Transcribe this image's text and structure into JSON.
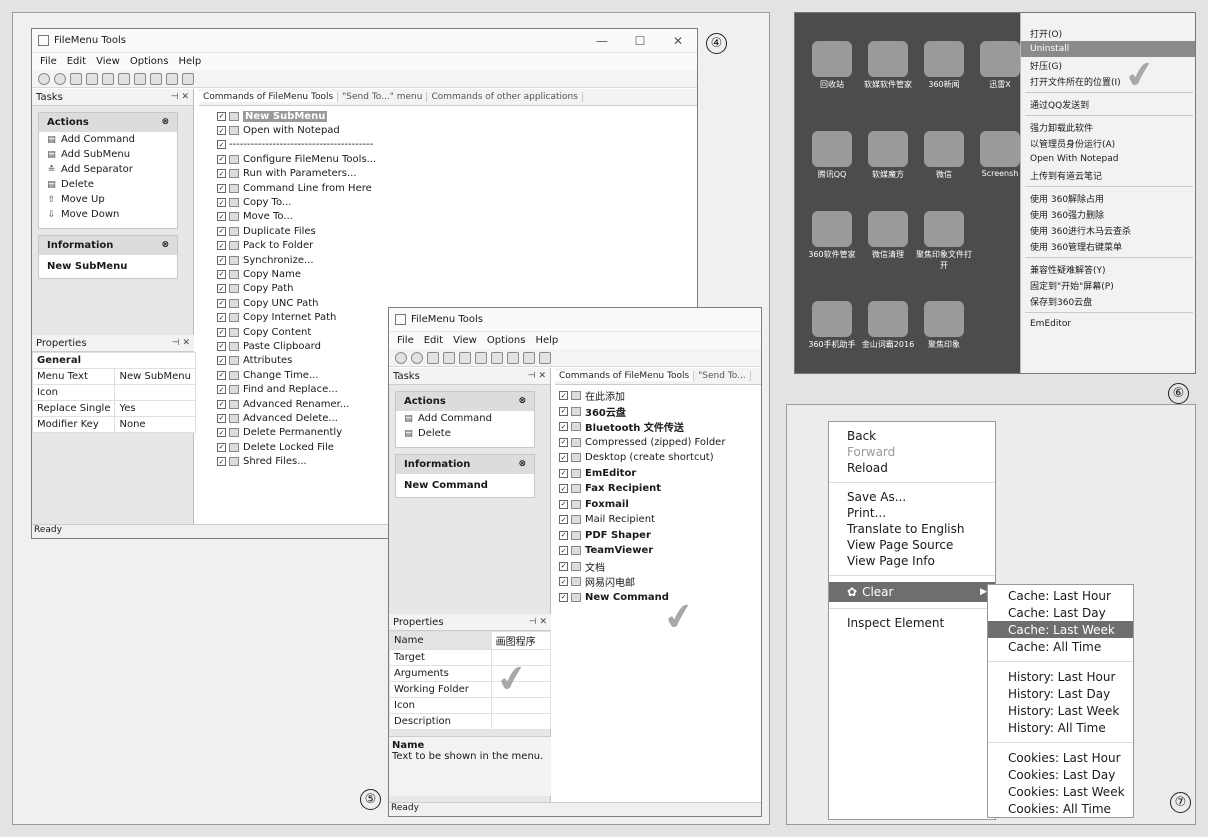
{
  "labels": {
    "n4": "④",
    "n5": "⑤",
    "n6": "⑥",
    "n7": "⑦"
  },
  "win4": {
    "title": "FileMenu Tools",
    "menu": [
      "File",
      "Edit",
      "View",
      "Options",
      "Help"
    ],
    "tasks_header": "Tasks",
    "actions_header": "Actions",
    "actions": [
      "Add Command",
      "Add SubMenu",
      "Add Separator",
      "Delete",
      "Move Up",
      "Move Down"
    ],
    "info_header": "Information",
    "info_text": "New SubMenu",
    "props_header": "Properties",
    "props_group": "General",
    "props": [
      [
        "Menu Text",
        "New SubMenu"
      ],
      [
        "Icon",
        ""
      ],
      [
        "Replace Single",
        "Yes"
      ],
      [
        "Modifier Key",
        "None"
      ]
    ],
    "tabs": [
      "Commands of FileMenu Tools",
      "\"Send To...\" menu",
      "Commands of other applications"
    ],
    "items": [
      "New SubMenu",
      "Open with Notepad",
      "----------------------------------------",
      "Configure FileMenu Tools...",
      "Run with Parameters...",
      "Command Line from Here",
      "Copy To...",
      "Move To...",
      "Duplicate Files",
      "Pack to Folder",
      "Synchronize...",
      "Copy Name",
      "Copy Path",
      "Copy UNC Path",
      "Copy Internet Path",
      "Copy Content",
      "Paste Clipboard",
      "Attributes",
      "Change Time...",
      "Find and Replace...",
      "Advanced Renamer...",
      "Advanced Delete...",
      "Delete Permanently",
      "Delete Locked File",
      "Shred Files..."
    ],
    "status": "Ready"
  },
  "win5": {
    "title": "FileMenu Tools",
    "menu": [
      "File",
      "Edit",
      "View",
      "Options",
      "Help"
    ],
    "tasks_header": "Tasks",
    "actions_header": "Actions",
    "actions": [
      "Add Command",
      "Delete"
    ],
    "info_header": "Information",
    "info_text": "New Command",
    "props_header": "Properties",
    "props": [
      [
        "Name",
        "画图程序"
      ],
      [
        "Target",
        ""
      ],
      [
        "Arguments",
        ""
      ],
      [
        "Working Folder",
        ""
      ],
      [
        "Icon",
        ""
      ],
      [
        "Description",
        ""
      ]
    ],
    "desc_title": "Name",
    "desc_text": "Text to be shown in the menu.",
    "tabs": [
      "Commands of FileMenu Tools",
      "\"Send To..."
    ],
    "items": [
      "在此添加",
      "360云盘",
      "Bluetooth 文件传送",
      "Compressed (zipped) Folder",
      "Desktop (create shortcut)",
      "EmEditor",
      "Fax Recipient",
      "Foxmail",
      "Mail Recipient",
      "PDF Shaper",
      "TeamViewer",
      "文档",
      "网易闪电邮",
      "New Command"
    ],
    "status": "Ready"
  },
  "desktop": {
    "icons": [
      "回收站",
      "软媒软件管家",
      "360新闻",
      "迅雷X",
      "腾讯QQ",
      "软媒魔方",
      "微信",
      "Screensh",
      "360软件管家",
      "微信清理",
      "聚焦印象文件打开",
      "",
      "360手机助手",
      "金山词霸2016",
      "聚焦印象"
    ],
    "menu": [
      "打开(O)",
      "Uninstall",
      "好压(G)",
      "打开文件所在的位置(I)",
      "通过QQ发送到",
      "强力卸载此软件",
      "以管理员身份运行(A)",
      "Open With Notepad",
      "上传到有道云笔记",
      "使用 360解除占用",
      "使用 360强力删除",
      "使用 360进行木马云查杀",
      "使用 360管理右键菜单",
      "兼容性疑难解答(Y)",
      "固定到\"开始\"屏幕(P)",
      "保存到360云盘",
      "EmEditor"
    ]
  },
  "mac": {
    "items": [
      "Back",
      "Forward",
      "Reload",
      "Save As...",
      "Print...",
      "Translate to English",
      "View Page Source",
      "View Page Info",
      "Clear",
      "Inspect Element"
    ],
    "sub": [
      "Cache: Last Hour",
      "Cache: Last Day",
      "Cache: Last Week",
      "Cache: All Time",
      "History: Last Hour",
      "History: Last Day",
      "History: Last Week",
      "History: All Time",
      "Cookies: Last Hour",
      "Cookies: Last Day",
      "Cookies: Last Week",
      "Cookies: All Time"
    ]
  }
}
